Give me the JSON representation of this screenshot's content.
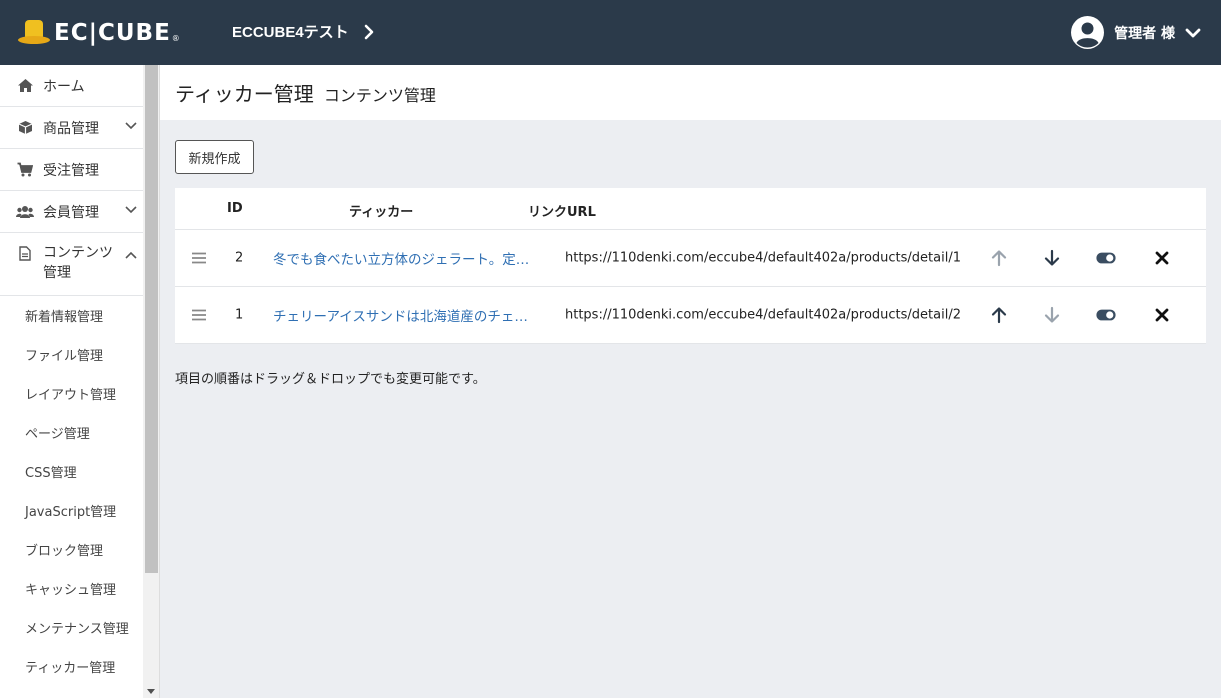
{
  "header": {
    "logo_text": "EC|CUBE",
    "logo_reg": "®",
    "shop_name": "ECCUBE4テスト",
    "user_label": "管理者 様"
  },
  "sidebar": {
    "items": [
      {
        "label": "ホーム",
        "icon": "home-icon"
      },
      {
        "label": "商品管理",
        "icon": "box-icon"
      },
      {
        "label": "受注管理",
        "icon": "cart-icon"
      },
      {
        "label": "会員管理",
        "icon": "users-icon"
      },
      {
        "label": "コンテンツ管理",
        "icon": "file-icon"
      }
    ],
    "sub_items": [
      "新着情報管理",
      "ファイル管理",
      "レイアウト管理",
      "ページ管理",
      "CSS管理",
      "JavaScript管理",
      "ブロック管理",
      "キャッシュ管理",
      "メンテナンス管理",
      "ティッカー管理"
    ]
  },
  "page": {
    "title": "ティッカー管理",
    "subtitle": "コンテンツ管理",
    "new_button": "新規作成",
    "note": "項目の順番はドラッグ＆ドロップでも変更可能です。"
  },
  "table": {
    "headers": {
      "id": "ID",
      "ticker": "ティッカー",
      "url": "リンクURL"
    },
    "rows": [
      {
        "id": "2",
        "ticker": "冬でも食べたい立方体のジェラート。定…",
        "url": "https://110denki.com/eccube4/default402a/products/detail/1",
        "up_enabled": false,
        "down_enabled": true
      },
      {
        "id": "1",
        "ticker": "チェリーアイスサンドは北海道産のチェ…",
        "url": "https://110denki.com/eccube4/default402a/products/detail/2",
        "up_enabled": true,
        "down_enabled": false
      }
    ]
  },
  "colors": {
    "header_bg": "#2b3a4a",
    "link": "#2f6fb3",
    "icon_active": "#2b3a4a",
    "icon_disabled": "#9aa3ad",
    "page_bg": "#eceef2"
  }
}
